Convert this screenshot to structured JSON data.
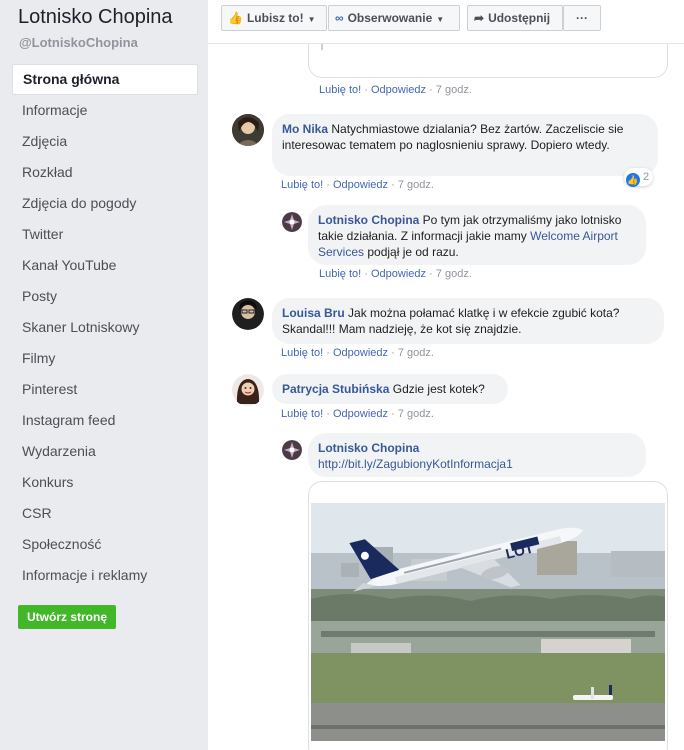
{
  "sidebar": {
    "page_name": "Lotnisko Chopina",
    "handle": "@LotniskoChopina",
    "items": [
      {
        "label": "Strona główna"
      },
      {
        "label": "Informacje"
      },
      {
        "label": "Zdjęcia"
      },
      {
        "label": "Rozkład"
      },
      {
        "label": "Zdjęcia do pogody"
      },
      {
        "label": "Twitter"
      },
      {
        "label": "Kanał YouTube"
      },
      {
        "label": "Posty"
      },
      {
        "label": "Skaner Lotniskowy"
      },
      {
        "label": "Filmy"
      },
      {
        "label": "Pinterest"
      },
      {
        "label": "Instagram feed"
      },
      {
        "label": "Wydarzenia"
      },
      {
        "label": "Konkurs"
      },
      {
        "label": "CSR"
      },
      {
        "label": "Społeczność"
      },
      {
        "label": "Informacje i reklamy"
      }
    ],
    "create_button": "Utwórz stronę"
  },
  "actionbar": {
    "like": "Lubisz to!",
    "follow": "Obserwowanie",
    "share": "Udostępnij",
    "more": "···"
  },
  "common": {
    "like": "Lubię to!",
    "reply": "Odpowiedz",
    "sep": " · ",
    "time": "7 godz."
  },
  "comments": [
    {
      "author": "Mo Nika",
      "text": "Natychmiastowe dzialania? Bez żartów. Zaczeliscie sie interesowac tematem po naglosnieniu sprawy. Dopiero wtedy.",
      "reactions": "2"
    },
    {
      "author": "Lotnisko Chopina",
      "text": "Po tym jak otrzymaliśmy jako lotnisko takie działania. Z informacji jakie mamy ",
      "link": "Welcome Airport Services",
      "text_after": " podjął je od razu."
    },
    {
      "author": "Louisa Bru",
      "text": "Jak można połamać klatkę i w efekcie zgubić kota? Skandal!!! Mam nadzieję, że kot się znajdzie."
    },
    {
      "author": "Patrycja Stubińska",
      "text": "Gdzie jest kotek?"
    },
    {
      "author": "Lotnisko Chopina",
      "link": "http://bit.ly/ZagubionyKotInformacja1"
    }
  ],
  "photo": {
    "airline": "LOT"
  },
  "colors": {
    "link": "#385898",
    "accent": "#4267b2",
    "green": "#42b72a",
    "sidebar_bg": "#e9ebee",
    "bubble": "#f2f3f5"
  }
}
